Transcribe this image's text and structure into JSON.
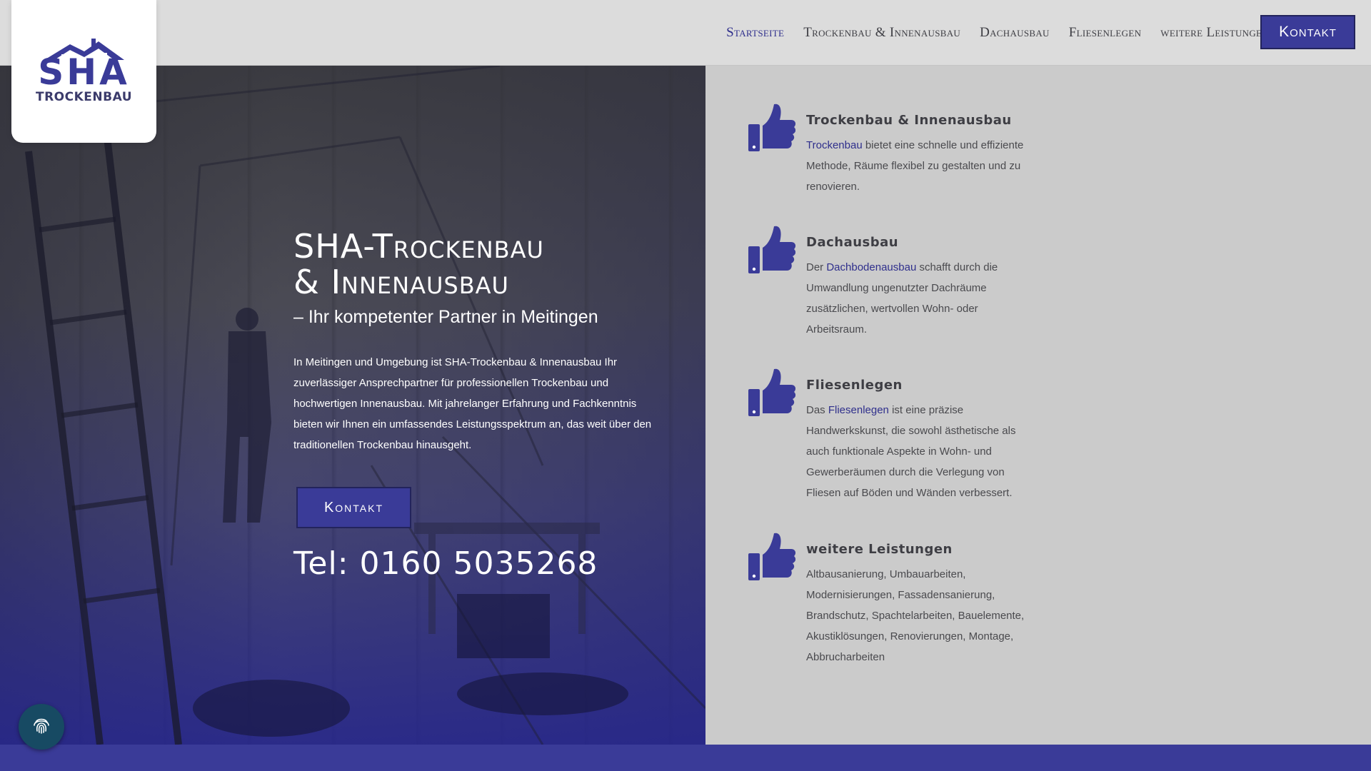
{
  "logo": {
    "wordmark": "SHA",
    "subtitle": "TROCKENBAU"
  },
  "nav": {
    "items": [
      {
        "label": "Startseite"
      },
      {
        "label": "Trockenbau & Innenausbau"
      },
      {
        "label": "Dachausbau"
      },
      {
        "label": "Fliesenlegen"
      },
      {
        "label": "weitere Leistungen"
      }
    ],
    "contact_label": "Kontakt"
  },
  "hero": {
    "title_line1": "SHA-Trockenbau",
    "title_line2": "& Innenausbau",
    "subtitle": "– Ihr kompetenter Partner in Meitingen",
    "text": "In Meitingen und Umgebung ist SHA-Trockenbau & Innenausbau Ihr zuverlässiger Ansprechpartner für professionellen Trockenbau und hochwertigen Innenausbau. Mit jahrelanger Erfahrung und Fachkenntnis bieten wir Ihnen ein umfassendes Leistungsspektrum an, das weit über den traditionellen Trockenbau hinausgeht.",
    "button_label": "Kontakt",
    "phone": "Tel: 0160 5035268"
  },
  "services": [
    {
      "title": "Trockenbau & Innenausbau",
      "prefix": "",
      "link": "Trockenbau",
      "suffix": " bietet eine schnelle und effiziente Methode, Räume flexibel zu gestalten und zu renovieren."
    },
    {
      "title": "Dachausbau",
      "prefix": "Der ",
      "link": "Dachbodenausbau",
      "suffix": " schafft durch die Umwandlung ungenutzter Dachräume zusätzlichen, wertvollen Wohn- oder Arbeitsraum."
    },
    {
      "title": "Fliesenlegen",
      "prefix": "Das ",
      "link": "Fliesenlegen",
      "suffix": " ist eine präzise Handwerkskunst, die sowohl ästhetische als auch funktionale Aspekte in Wohn- und Gewerberäumen durch die Verlegung von Fliesen auf Böden und Wänden verbessert."
    },
    {
      "title": "weitere Leistungen",
      "prefix": "Altbausanierung, Umbauarbeiten, Modernisierungen, Fassadensanierung, Brandschutz, Spachtelarbeiten, Bauelemente, Akustiklösungen, Renovierungen, Montage, Abbrucharbeiten",
      "link": "",
      "suffix": ""
    }
  ],
  "colors": {
    "brand": "#3a3b98",
    "header_bg": "#dcdcdc",
    "panel_bg": "#cbcbcb",
    "link": "#2f2f8c",
    "cookie_button": "#174a63"
  },
  "icons": [
    "house-roof-icon",
    "chevron-down-icon",
    "thumbs-up-icon",
    "fingerprint-icon"
  ]
}
